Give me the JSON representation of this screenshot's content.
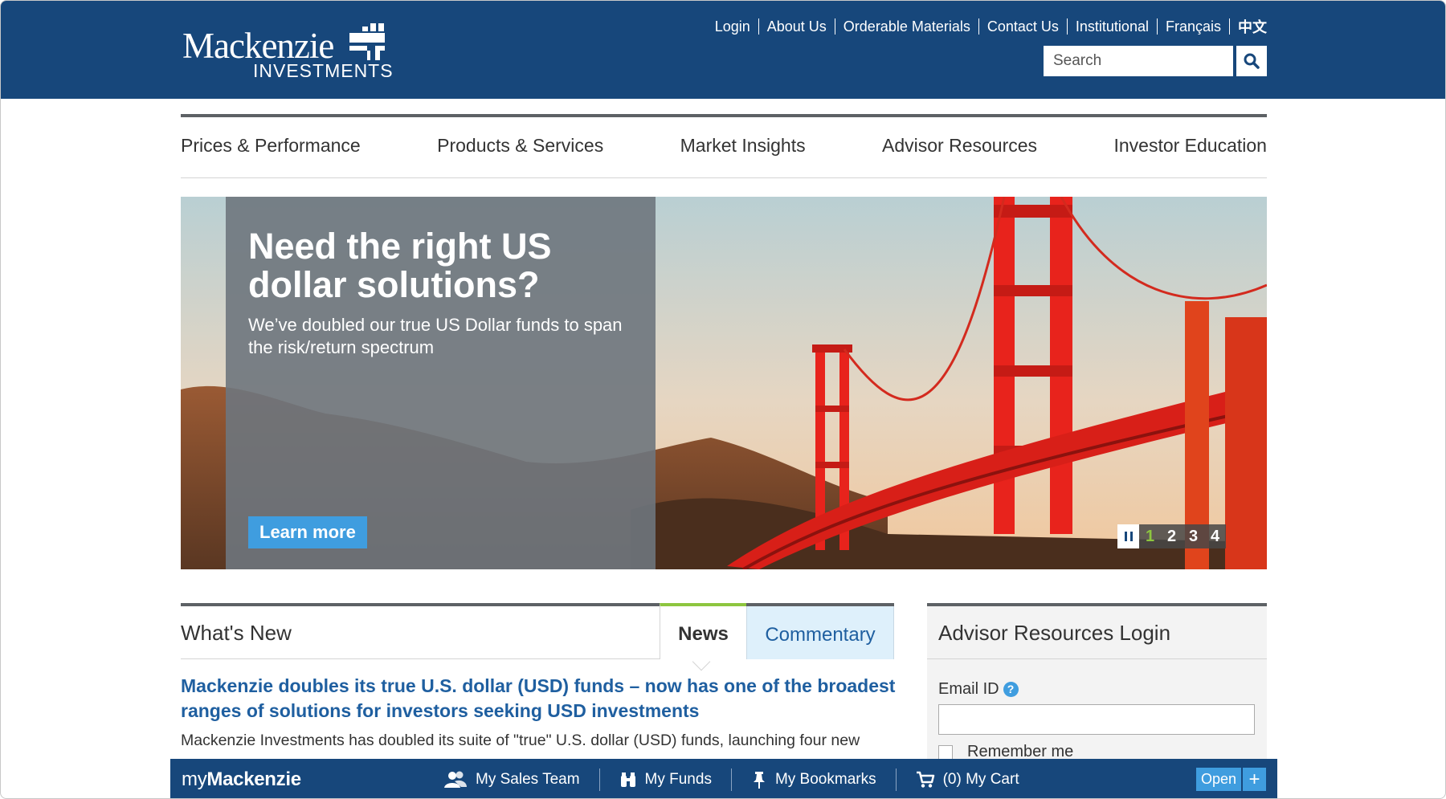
{
  "header": {
    "logo_text": "Mackenzie",
    "logo_subtext": "INVESTMENTS",
    "utility_links": [
      "Login",
      "About Us",
      "Orderable Materials",
      "Contact Us",
      "Institutional",
      "Français",
      "中文"
    ],
    "search_placeholder": "Search"
  },
  "nav": {
    "items": [
      "Prices & Performance",
      "Products & Services",
      "Market Insights",
      "Advisor Resources",
      "Investor Education"
    ]
  },
  "hero": {
    "title": "Need the right US dollar solutions?",
    "subtitle": "We’ve doubled our true US Dollar funds to span the risk/return spectrum",
    "cta": "Learn more",
    "slides": [
      "1",
      "2",
      "3",
      "4"
    ],
    "active_slide": "1"
  },
  "whats_new": {
    "title": "What's New",
    "tabs": [
      "News",
      "Commentary"
    ],
    "active_tab": "News",
    "headline": "Mackenzie doubles its true U.S. dollar (USD) funds – now has one of the broadest ranges of solutions for investors seeking USD investments",
    "body": "Mackenzie Investments has doubled its suite of \"true\" U.S. dollar (USD) funds, launching four new"
  },
  "login": {
    "title": "Advisor Resources Login",
    "email_label": "Email ID",
    "help_glyph": "?",
    "remember_label": "Remember me"
  },
  "mybar": {
    "brand_my": "my",
    "brand_name": "Mackenzie",
    "items": [
      "My Sales Team",
      "My Funds",
      "My Bookmarks",
      "(0) My Cart"
    ],
    "open_label": "Open",
    "plus_glyph": "+"
  },
  "colors": {
    "brand_blue": "#17477b",
    "accent_blue": "#3f9ddf",
    "link_blue": "#1f5fa0",
    "accent_green": "#8dc63f",
    "bridge_red": "#e8231c"
  }
}
